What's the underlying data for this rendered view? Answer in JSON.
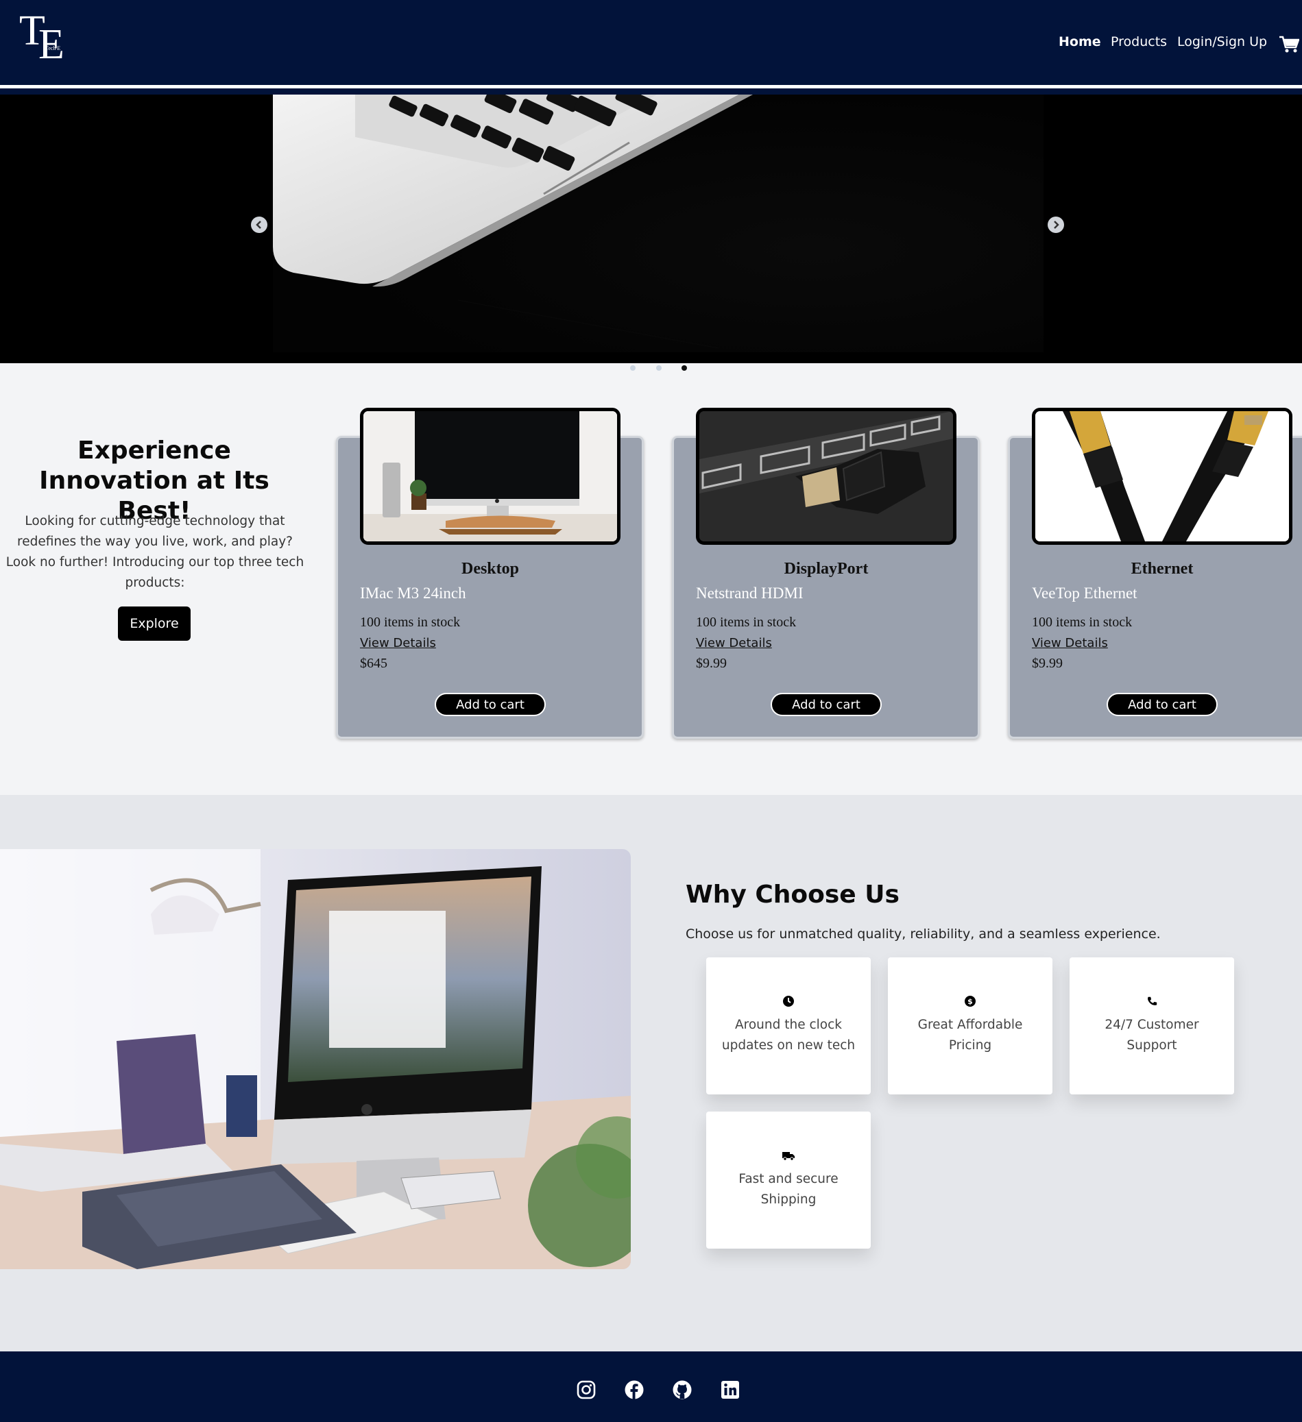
{
  "header": {
    "logo_letters_1": "T",
    "logo_letters_2": "E",
    "logo_sub": "Tech E",
    "nav": [
      {
        "label": "Home",
        "active": true
      },
      {
        "label": "Products"
      },
      {
        "label": "Login/Sign Up"
      }
    ],
    "cart_icon": "shopping-cart-icon"
  },
  "carousel": {
    "prev_icon": "chevron-left-icon",
    "next_icon": "chevron-right-icon",
    "slide_count": 3,
    "active_slide": 3
  },
  "intro": {
    "heading": "Experience Innovation at Its Best!",
    "text": "Looking for cutting-edge technology that redefines the way you live, work, and play? Look no further! Introducing our top three tech products:",
    "button": "Explore"
  },
  "products": [
    {
      "category": "Desktop",
      "name": "IMac M3 24inch",
      "stock": "100 items in stock",
      "link": "View Details",
      "price": "$645",
      "button": "Add to cart"
    },
    {
      "category": "DisplayPort",
      "name": "Netstrand HDMI",
      "stock": "100 items in stock",
      "link": "View Details",
      "price": "$9.99",
      "button": "Add to cart"
    },
    {
      "category": "Ethernet",
      "name": "VeeTop Ethernet",
      "stock": "100 items in stock",
      "link": "View Details",
      "price": "$9.99",
      "button": "Add to cart"
    }
  ],
  "why": {
    "title": "Why Choose Us",
    "subtitle": "Choose us for unmatched quality, reliability, and a seamless experience.",
    "features": [
      {
        "icon": "clock-icon",
        "text": "Around the clock updates on new tech"
      },
      {
        "icon": "dollar-icon",
        "text": "Great Affordable Pricing"
      },
      {
        "icon": "phone-icon",
        "text": "24/7 Customer Support"
      },
      {
        "icon": "truck-icon",
        "text": "Fast and secure Shipping"
      }
    ]
  },
  "footer": {
    "social": [
      "instagram-icon",
      "facebook-icon",
      "github-icon",
      "linkedin-icon"
    ]
  },
  "colors": {
    "navy": "#02133a",
    "card_gray": "#9aa1ae",
    "page_bg": "#f3f4f6",
    "section_bg": "#e5e7eb"
  }
}
